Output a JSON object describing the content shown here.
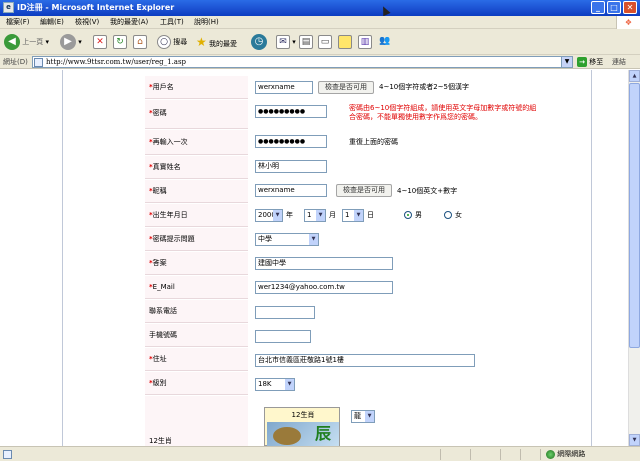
{
  "window": {
    "title": "ID注冊 - Microsoft Internet Explorer",
    "minimize": "_",
    "maximize": "□",
    "close": "✕"
  },
  "menu": [
    "檔案(F)",
    "編輯(E)",
    "檢視(V)",
    "我的最愛(A)",
    "工具(T)",
    "說明(H)"
  ],
  "toolbar": {
    "back": "上一頁",
    "search": "搜尋",
    "favorites": "我的最愛"
  },
  "address": {
    "label": "網址(D)",
    "url": "http://www.9ttsr.com.tw/user/reg_1.asp",
    "go": "移至",
    "links": "連結"
  },
  "form": {
    "username": {
      "label": "用戶名",
      "value": "werxname",
      "check_btn": "檢查是否可用",
      "hint": "4~10個字符或者2~5個漢字"
    },
    "password": {
      "label": "密碼",
      "value": "●●●●●●●●●",
      "hint1": "密碼由6~10個字符組成，請使用英文字母加數字或符號的組",
      "hint2": "合密碼，不能單獨使用數字作爲您的密碼。"
    },
    "confirm": {
      "label": "再輸入一次",
      "value": "●●●●●●●●●",
      "hint": "重復上面的密碼"
    },
    "realname": {
      "label": "真實姓名",
      "value": "林小明"
    },
    "nickname": {
      "label": "昵稱",
      "value": "werxname",
      "check_btn": "檢查是否可用",
      "hint": "4~10個英文+數字"
    },
    "birthday": {
      "label": "出生年月日",
      "year": "2000",
      "year_unit": "年",
      "month": "1",
      "month_unit": "月",
      "day": "1",
      "day_unit": "日",
      "male": "男",
      "female": "女",
      "gender_selected": "male"
    },
    "question": {
      "label": "密碼提示問題",
      "value": "中學"
    },
    "answer": {
      "label": "答案",
      "value": "建國中學"
    },
    "email": {
      "label": "E_Mail",
      "value": "wer1234@yahoo.com.tw"
    },
    "phone": {
      "label": "聯系電話",
      "value": ""
    },
    "mobile": {
      "label": "手機號碼",
      "value": ""
    },
    "address": {
      "label": "住址",
      "value": "台北市信義區莊敬路1號1樓"
    },
    "level": {
      "label": "級別",
      "value": "18K"
    },
    "zodiac": {
      "label": "12生肖",
      "title": "12生肖",
      "value": "龍",
      "glyph": "辰"
    },
    "required_mark": "*"
  },
  "status": {
    "zone": "網際網路"
  },
  "colors": {
    "titlebar": "#1a4fd0",
    "required": "#e00000",
    "label_bg": "#fdf5f7"
  }
}
